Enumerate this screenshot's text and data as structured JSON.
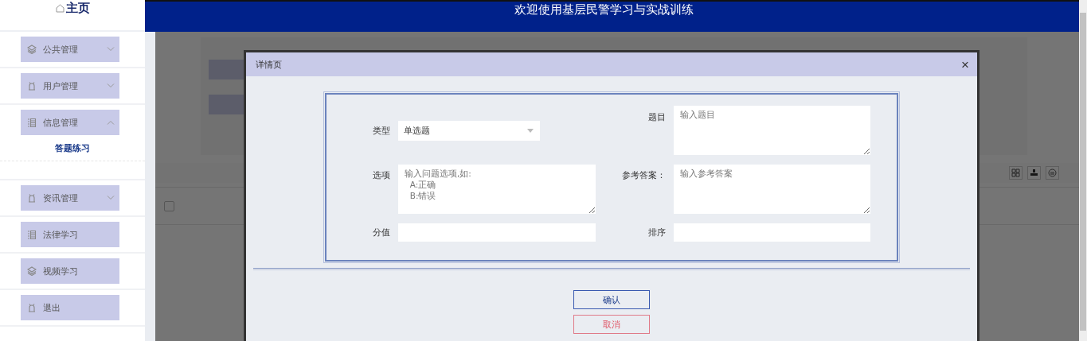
{
  "header": {
    "home_label": "主页",
    "title": "欢迎使用基层民警学习与实战训练"
  },
  "sidebar": {
    "items": [
      {
        "label": "公共管理",
        "kind": "layers",
        "expanded": false
      },
      {
        "label": "用户管理",
        "kind": "bell",
        "expanded": false
      },
      {
        "label": "信息管理",
        "kind": "list",
        "expanded": true,
        "children": [
          {
            "label": "答题练习"
          }
        ]
      },
      {
        "label": "资讯管理",
        "kind": "bell",
        "expanded": false
      },
      {
        "label": "法律学习",
        "kind": "list"
      },
      {
        "label": "视频学习",
        "kind": "layers"
      },
      {
        "label": "退出",
        "kind": "bell"
      }
    ]
  },
  "table": {
    "rows": [
      {
        "checked": false
      }
    ]
  },
  "dialog": {
    "title": "详情页",
    "close": "×",
    "fields": [
      {
        "kind": "select",
        "label": "类型",
        "value": "单选题"
      },
      {
        "kind": "textarea",
        "label": "题目",
        "placeholder": "输入题目"
      },
      {
        "kind": "textarea",
        "label": "选项",
        "placeholder": "输入问题选项,如:\n  A:正确\n  B:错误"
      },
      {
        "kind": "textarea",
        "label": "参考答案：",
        "placeholder": "输入参考答案"
      },
      {
        "kind": "input",
        "label": "分值"
      },
      {
        "kind": "input",
        "label": "排序"
      }
    ],
    "buttons": [
      {
        "label": "确认",
        "kind": "confirm"
      },
      {
        "label": "取消",
        "kind": "cancel"
      }
    ]
  }
}
